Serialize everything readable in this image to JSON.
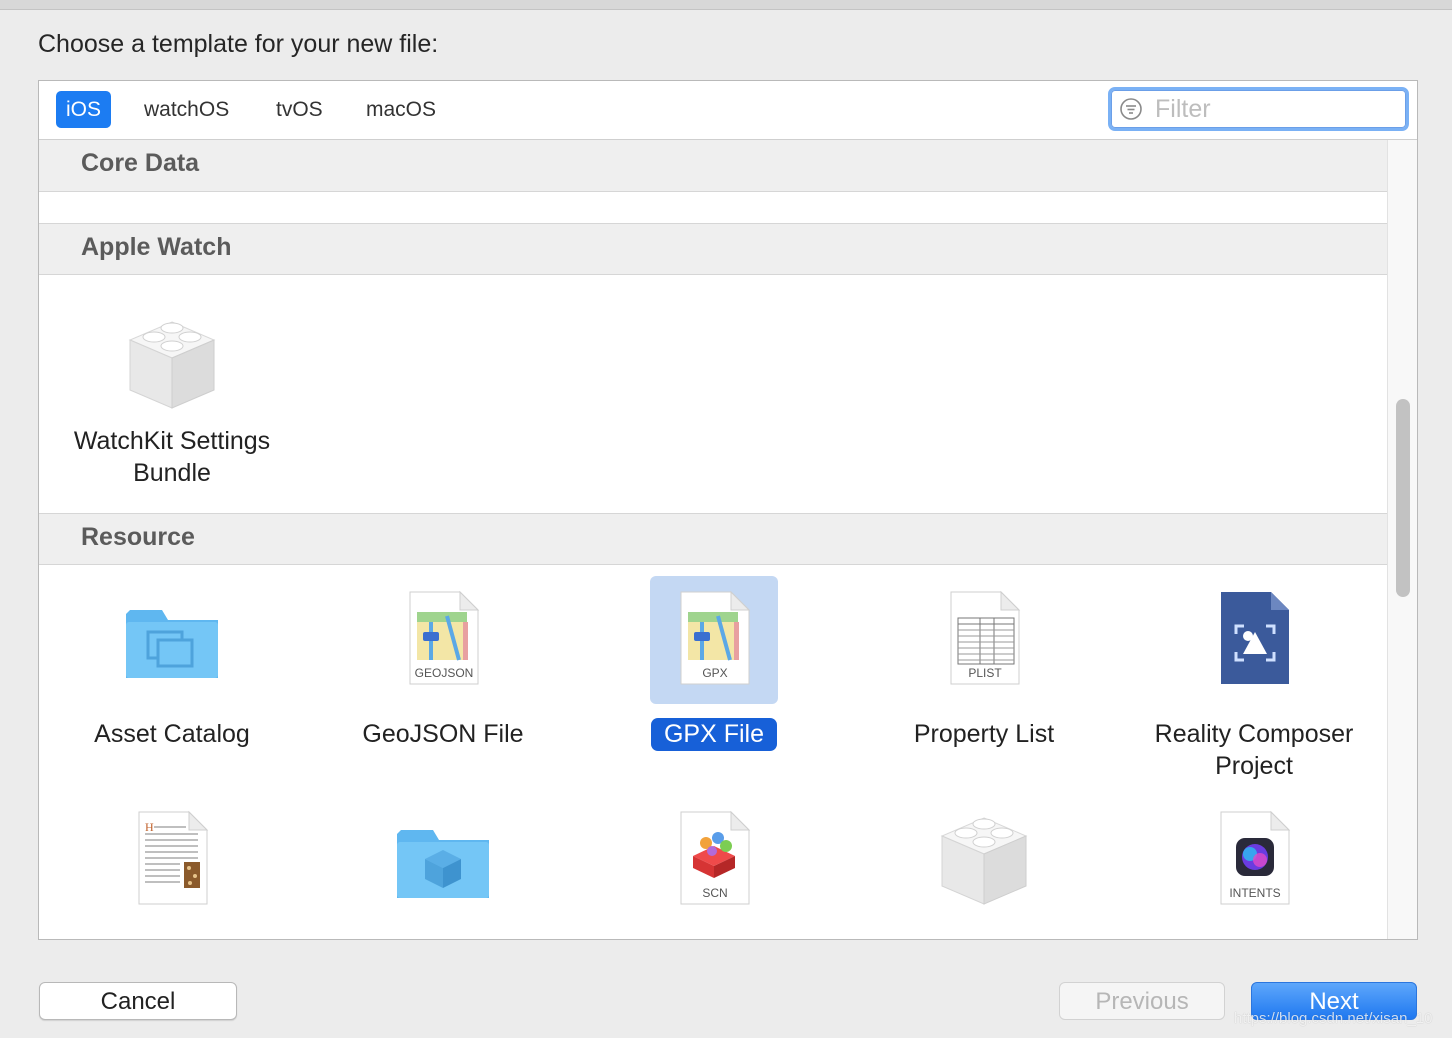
{
  "dialog": {
    "title": "Choose a template for your new file:"
  },
  "tabs": [
    {
      "label": "iOS",
      "active": true
    },
    {
      "label": "watchOS",
      "active": false
    },
    {
      "label": "tvOS",
      "active": false
    },
    {
      "label": "macOS",
      "active": false
    }
  ],
  "filter": {
    "placeholder": "Filter",
    "icon": "filter-icon"
  },
  "sections": [
    {
      "title": "Core Data",
      "items": []
    },
    {
      "title": "Apple Watch",
      "items": [
        {
          "label_lines": [
            "WatchKit Settings",
            "Bundle"
          ],
          "icon": "lego-brick-icon"
        }
      ]
    },
    {
      "title": "Resource",
      "items": [
        {
          "label_lines": [
            "Asset Catalog"
          ],
          "icon": "folder-icon"
        },
        {
          "label_lines": [
            "GeoJSON File"
          ],
          "icon": "map-document-icon",
          "badge": "GEOJSON"
        },
        {
          "label_lines": [
            "GPX File"
          ],
          "icon": "map-document-icon",
          "badge": "GPX",
          "selected": true
        },
        {
          "label_lines": [
            "Property List"
          ],
          "icon": "plist-document-icon",
          "badge": "PLIST"
        },
        {
          "label_lines": [
            "Reality Composer",
            "Project"
          ],
          "icon": "reality-composer-icon"
        },
        {
          "label_lines": [],
          "icon": "rich-text-document-icon"
        },
        {
          "label_lines": [],
          "icon": "scenekit-folder-icon"
        },
        {
          "label_lines": [],
          "icon": "scenekit-document-icon",
          "badge": "SCN"
        },
        {
          "label_lines": [],
          "icon": "lego-brick-icon"
        },
        {
          "label_lines": [],
          "icon": "siri-intents-icon",
          "badge": "INTENTS"
        }
      ]
    }
  ],
  "buttons": {
    "cancel": "Cancel",
    "previous": "Previous",
    "next": "Next"
  },
  "watermark": "https://blog.csdn.net/xisan_10",
  "colors": {
    "accent": "#1c7cf2",
    "selection": "#1760d8",
    "selection_bg": "#c4d8f3",
    "section_header": "#efefef"
  }
}
